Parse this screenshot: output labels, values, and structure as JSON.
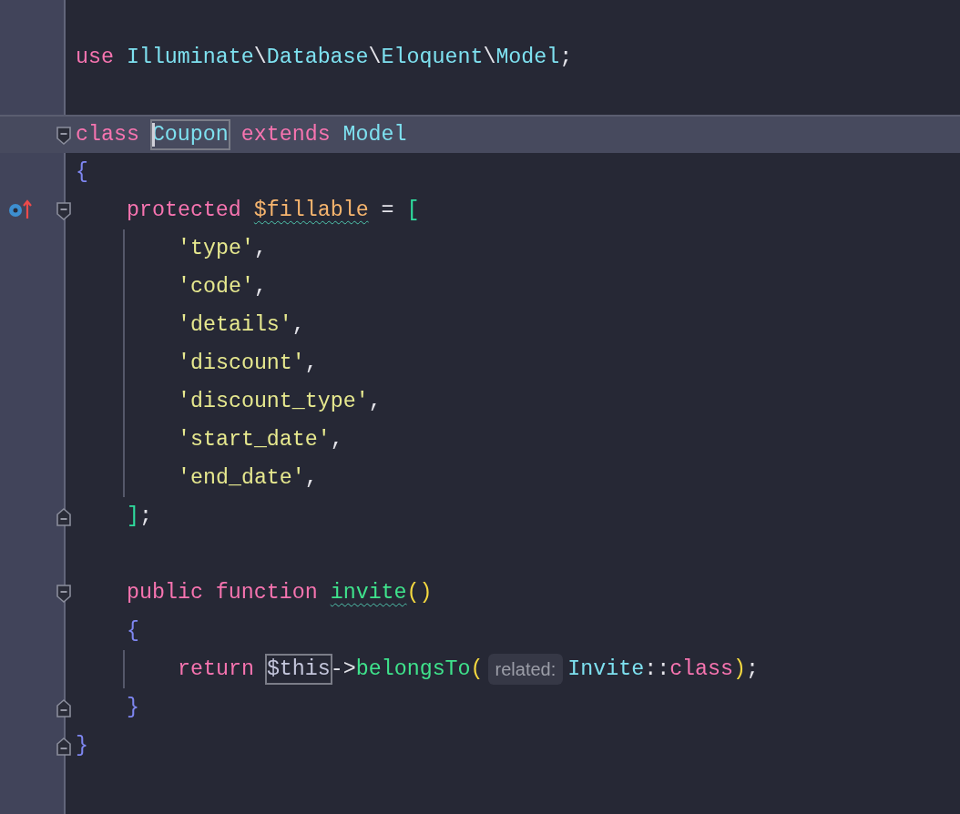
{
  "editor": {
    "lines": [
      {
        "kind": "blank"
      },
      {
        "kind": "top",
        "tokens": [
          {
            "kind": "keyword",
            "text": "use "
          },
          {
            "kind": "type",
            "text": "Illuminate"
          },
          {
            "kind": "punct",
            "text": "\\"
          },
          {
            "kind": "type",
            "text": "Database"
          },
          {
            "kind": "punct",
            "text": "\\"
          },
          {
            "kind": "type",
            "text": "Eloquent"
          },
          {
            "kind": "punct",
            "text": "\\"
          },
          {
            "kind": "type",
            "text": "Model"
          },
          {
            "kind": "punct",
            "text": ";"
          }
        ]
      },
      {
        "kind": "blank"
      },
      {
        "kind": "top",
        "current": true,
        "fold_start": true,
        "tokens": [
          {
            "kind": "keyword",
            "text": "class "
          },
          {
            "kind": "type",
            "text": "Coupon",
            "boxed": true,
            "caret": true
          },
          {
            "kind": "keyword",
            "text": " extends "
          },
          {
            "kind": "type",
            "text": "Model"
          }
        ]
      },
      {
        "kind": "top",
        "tokens": [
          {
            "kind": "brace",
            "text": "{"
          }
        ]
      },
      {
        "kind": "member",
        "fold_start": true,
        "overrides": true,
        "tokens": [
          {
            "kind": "keyword",
            "text": "protected "
          },
          {
            "kind": "variable",
            "text": "$fillable",
            "warning": true
          },
          {
            "kind": "punct",
            "text": " = "
          },
          {
            "kind": "bracket",
            "text": "["
          }
        ]
      },
      {
        "kind": "body",
        "guide": true,
        "tokens": [
          {
            "kind": "string",
            "text": "'type'"
          },
          {
            "kind": "punct",
            "text": ","
          }
        ]
      },
      {
        "kind": "body",
        "guide": true,
        "tokens": [
          {
            "kind": "string",
            "text": "'code'"
          },
          {
            "kind": "punct",
            "text": ","
          }
        ]
      },
      {
        "kind": "body",
        "guide": true,
        "tokens": [
          {
            "kind": "string",
            "text": "'details'"
          },
          {
            "kind": "punct",
            "text": ","
          }
        ]
      },
      {
        "kind": "body",
        "guide": true,
        "tokens": [
          {
            "kind": "string",
            "text": "'discount'"
          },
          {
            "kind": "punct",
            "text": ","
          }
        ]
      },
      {
        "kind": "body",
        "guide": true,
        "tokens": [
          {
            "kind": "string",
            "text": "'discount_type'"
          },
          {
            "kind": "punct",
            "text": ","
          }
        ]
      },
      {
        "kind": "body",
        "guide": true,
        "tokens": [
          {
            "kind": "string",
            "text": "'start_date'"
          },
          {
            "kind": "punct",
            "text": ","
          }
        ]
      },
      {
        "kind": "body",
        "guide": true,
        "tokens": [
          {
            "kind": "string",
            "text": "'end_date'"
          },
          {
            "kind": "punct",
            "text": ","
          }
        ]
      },
      {
        "kind": "member",
        "fold_end": true,
        "tokens": [
          {
            "kind": "bracket",
            "text": "]"
          },
          {
            "kind": "punct",
            "text": ";"
          }
        ]
      },
      {
        "kind": "blank"
      },
      {
        "kind": "member",
        "fold_start": true,
        "tokens": [
          {
            "kind": "keyword",
            "text": "public function "
          },
          {
            "kind": "function",
            "text": "invite",
            "warning": true
          },
          {
            "kind": "paren",
            "text": "()"
          }
        ]
      },
      {
        "kind": "member",
        "tokens": [
          {
            "kind": "brace",
            "text": "{"
          }
        ]
      },
      {
        "kind": "body",
        "guide": true,
        "tokens": [
          {
            "kind": "keyword",
            "text": "return "
          },
          {
            "kind": "this",
            "text": "$this",
            "boxed": true
          },
          {
            "kind": "punct",
            "text": "->"
          },
          {
            "kind": "function",
            "text": "belongsTo"
          },
          {
            "kind": "paren",
            "text": "("
          },
          {
            "kind": "hint",
            "text": "related:"
          },
          {
            "kind": "type",
            "text": "Invite"
          },
          {
            "kind": "punct",
            "text": "::"
          },
          {
            "kind": "keyword",
            "text": "class"
          },
          {
            "kind": "paren",
            "text": ")"
          },
          {
            "kind": "punct",
            "text": ";"
          }
        ]
      },
      {
        "kind": "member",
        "fold_end": true,
        "tokens": [
          {
            "kind": "brace",
            "text": "}"
          }
        ]
      },
      {
        "kind": "top",
        "fold_end": true,
        "tokens": [
          {
            "kind": "brace",
            "text": "}"
          }
        ]
      },
      {
        "kind": "blank"
      }
    ]
  }
}
